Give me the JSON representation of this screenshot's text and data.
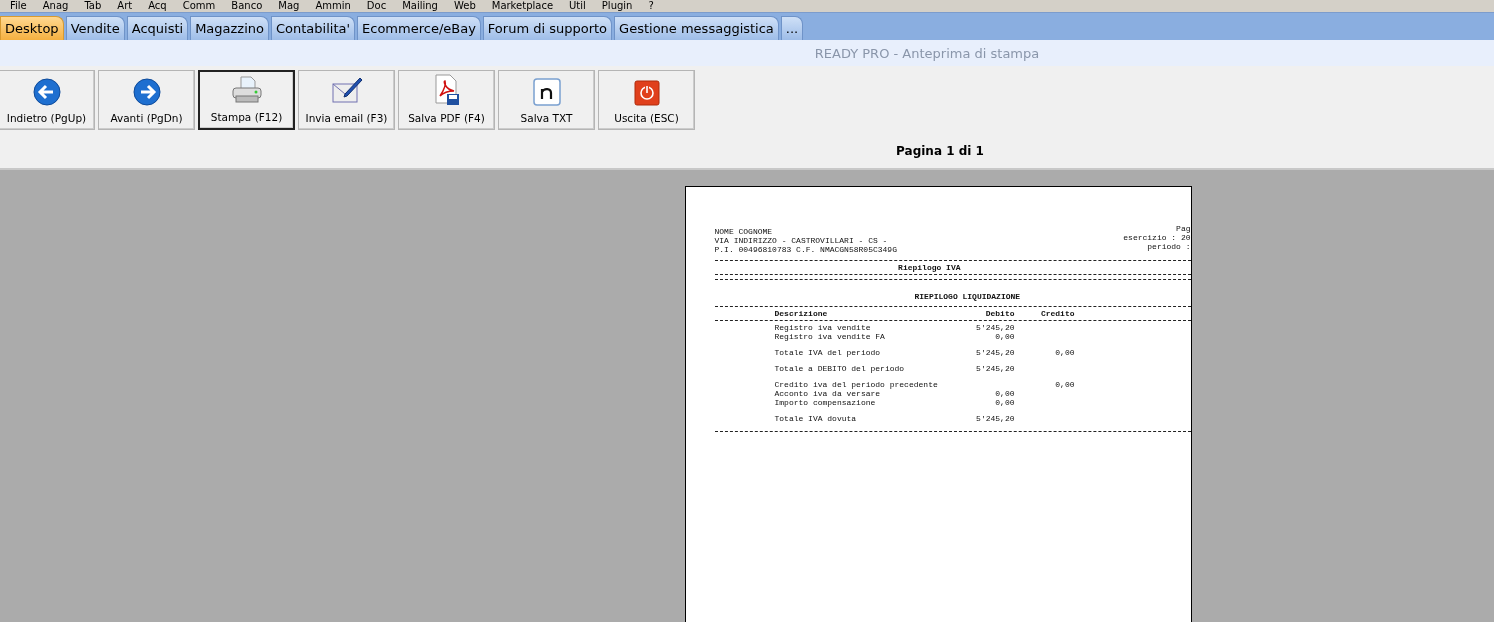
{
  "menu": [
    "File",
    "Anag",
    "Tab",
    "Art",
    "Acq",
    "Comm",
    "Banco",
    "Mag",
    "Ammin",
    "Doc",
    "Mailing",
    "Web",
    "Marketplace",
    "Util",
    "Plugin",
    "?"
  ],
  "tabs": [
    {
      "label": "Desktop",
      "selected": true
    },
    {
      "label": "Vendite",
      "selected": false
    },
    {
      "label": "Acquisti",
      "selected": false
    },
    {
      "label": "Magazzino",
      "selected": false
    },
    {
      "label": "Contabilita'",
      "selected": false
    },
    {
      "label": "Ecommerce/eBay",
      "selected": false
    },
    {
      "label": "Forum di supporto",
      "selected": false
    },
    {
      "label": "Gestione messaggistica",
      "selected": false
    },
    {
      "label": "...",
      "selected": false
    }
  ],
  "window": {
    "title": "READY PRO - Anteprima di stampa"
  },
  "toolbar": [
    {
      "kind": "back",
      "label": "Indietro (PgUp)",
      "selected": false
    },
    {
      "kind": "forward",
      "label": "Avanti (PgDn)",
      "selected": false
    },
    {
      "kind": "print",
      "label": "Stampa (F12)",
      "selected": true
    },
    {
      "kind": "email",
      "label": "Invia email (F3)",
      "selected": false
    },
    {
      "kind": "pdf",
      "label": "Salva PDF (F4)",
      "selected": false
    },
    {
      "kind": "txt",
      "label": "Salva TXT",
      "selected": false
    },
    {
      "kind": "exit",
      "label": "Uscita (ESC)",
      "selected": false
    }
  ],
  "page_indicator": "Pagina 1 di 1",
  "document": {
    "header_left": [
      "NOME COGNOME",
      "VIA INDIRIZZO - CASTROVILLARI - CS -",
      "P.I. 00496810783    C.F. NMACGN58R05C349G"
    ],
    "header_right": [
      "Pag",
      "esercizio : 20",
      "periodo :"
    ],
    "title": "Riepilogo IVA",
    "section": "RIEPILOGO LIQUIDAZIONE",
    "columns": [
      "Descrizione",
      "Debito",
      "Credito"
    ],
    "row_groups": [
      [
        {
          "description": "Registro iva vendite",
          "debito": "5'245,20"
        },
        {
          "description": "Registro iva vendite FA",
          "debito": "0,00"
        }
      ],
      [
        {
          "description": "Totale IVA del periodo",
          "debito": "5'245,20",
          "credito": "0,00"
        }
      ],
      [
        {
          "description": "Totale a DEBITO del periodo",
          "debito": "5'245,20"
        }
      ],
      [
        {
          "description": "Credito iva del periodo precedente",
          "credito": "0,00"
        },
        {
          "description": "Acconto iva da versare",
          "debito": "0,00"
        },
        {
          "description": "Importo compensazione",
          "debito": "0,00"
        }
      ],
      [
        {
          "description": "Totale IVA dovuta",
          "debito": "5'245,20"
        }
      ]
    ]
  }
}
